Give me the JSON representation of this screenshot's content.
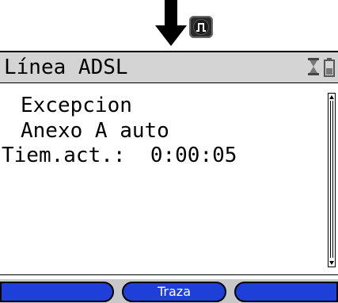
{
  "indicator": {
    "arrow_icon": "down-arrow-icon",
    "key_icon": "pulse-key-icon"
  },
  "screen": {
    "title": "Línea ADSL",
    "status_icons": [
      "hourglass-icon",
      "battery-icon"
    ],
    "lines": [
      "Excepcion",
      "Anexo A auto",
      "Tiem.act.:  0:00:05"
    ]
  },
  "softkeys": {
    "left": "",
    "middle": "Traza",
    "right": ""
  },
  "colors": {
    "softkey_fill": "#1f3fd9",
    "title_bar": "#d4d4d4"
  }
}
